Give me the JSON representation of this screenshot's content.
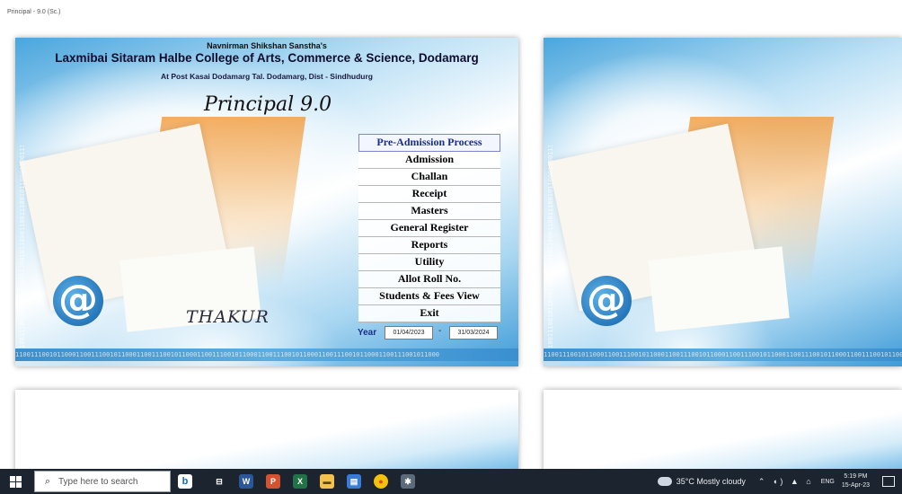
{
  "window": {
    "title": "Principal - 9.0 (Sc.)"
  },
  "header": {
    "society": "Navnirman Shikshan Sanstha's",
    "college": "Laxmibai Sitaram Halbe College of Arts, Commerce & Science, Dodamarg",
    "address": "At Post Kasai Dodamarg Tal. Dodamarg, Dist - Sindhudurg",
    "app_name": "Principal 9.0"
  },
  "menu": {
    "items": [
      "Pre-Admission Process",
      "Admission",
      "Challan",
      "Receipt",
      "Masters",
      "General Register",
      "Reports",
      "Utility",
      "Allot Roll No.",
      "Students & Fees View",
      "Exit"
    ],
    "active_index": 0
  },
  "footer": {
    "author": "THAKUR",
    "year_label": "Year",
    "year_from": "01/04/2023",
    "year_separator": "-",
    "year_to": "31/03/2024"
  },
  "decor": {
    "binary_text": "1100111001011000110011100101100011001110010110001100111001011000110011100101100011001110010110001100111001011000",
    "at_symbol": "@"
  },
  "taskbar": {
    "search_placeholder": "Type here to search",
    "apps": [
      {
        "name": "task-view",
        "glyph": "⊟",
        "color": "#1c2430"
      },
      {
        "name": "word",
        "glyph": "W",
        "color": "#2b579a"
      },
      {
        "name": "powerpoint",
        "glyph": "P",
        "color": "#d35230"
      },
      {
        "name": "excel",
        "glyph": "X",
        "color": "#217346"
      },
      {
        "name": "file-explorer",
        "glyph": "▬",
        "color": "#f2c14e"
      },
      {
        "name": "notepad",
        "glyph": "▤",
        "color": "#3a7bd5"
      },
      {
        "name": "chrome",
        "glyph": "●",
        "color": "#db4437"
      },
      {
        "name": "settings",
        "glyph": "✱",
        "color": "#5c6b7a"
      }
    ],
    "weather": "35°C  Mostly cloudy",
    "language": "ENG",
    "time": "5:19 PM",
    "date": "15-Apr-23"
  }
}
